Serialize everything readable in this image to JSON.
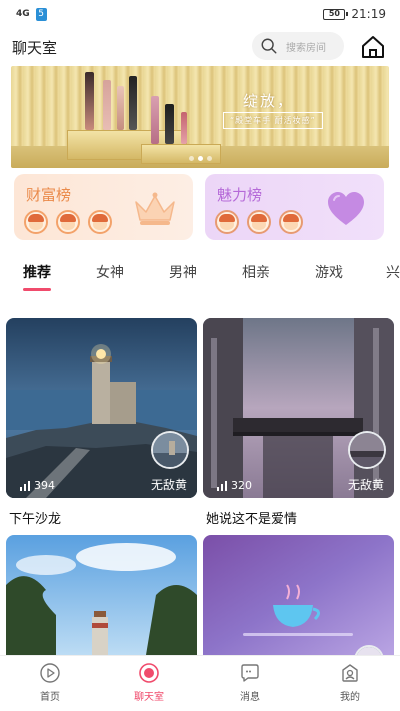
{
  "status_bar": {
    "signal_text": "4G",
    "wifi_badge": "5",
    "battery": "50",
    "time": "21:19"
  },
  "header": {
    "title": "聊天室",
    "search_placeholder": "搜索房间"
  },
  "banner": {
    "title": "绽放，",
    "subtitle": "“殿堂车手 耐活妆感”",
    "dot_count": 3,
    "active_dot": 1
  },
  "rankings": {
    "wealth": {
      "label": "财富榜"
    },
    "charm": {
      "label": "魅力榜"
    }
  },
  "tabs": [
    {
      "label": "推荐",
      "active": true
    },
    {
      "label": "女神",
      "active": false
    },
    {
      "label": "男神",
      "active": false
    },
    {
      "label": "相亲",
      "active": false
    },
    {
      "label": "游戏",
      "active": false
    },
    {
      "label": "兴",
      "active": false
    }
  ],
  "rooms": [
    {
      "title": "下午沙龙",
      "count": "394",
      "host": "无敌黄"
    },
    {
      "title": "她说这不是爱情",
      "count": "320",
      "host": "无敌黄"
    },
    {
      "title": "",
      "count": "",
      "host": ""
    },
    {
      "title": "",
      "count": "",
      "host": ""
    }
  ],
  "bottom_nav": [
    {
      "label": "首页",
      "icon": "play-circle-icon",
      "active": false
    },
    {
      "label": "聊天室",
      "icon": "record-icon",
      "active": true
    },
    {
      "label": "消息",
      "icon": "message-icon",
      "active": false
    },
    {
      "label": "我的",
      "icon": "profile-icon",
      "active": false
    }
  ],
  "colors": {
    "accent": "#f04b6c",
    "wealth_text": "#ea8a4a",
    "charm_text": "#b56ad8"
  }
}
